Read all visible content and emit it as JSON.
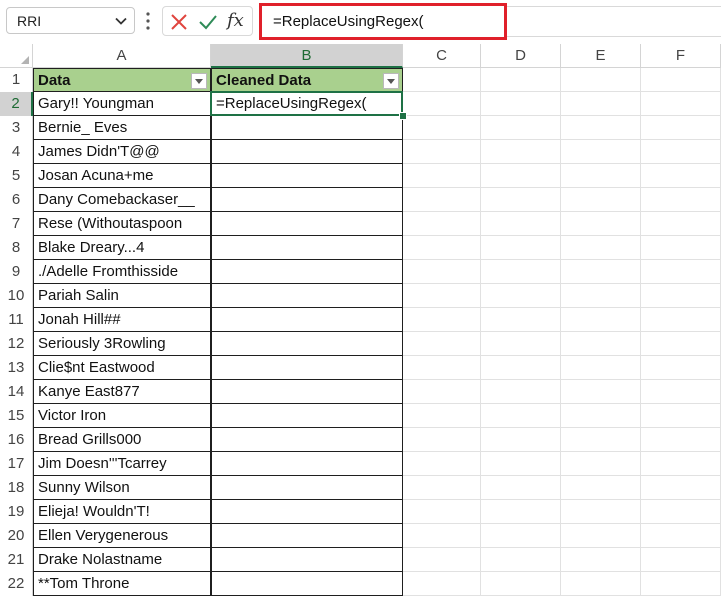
{
  "formula_bar": {
    "name_box": "RRI",
    "formula": "=ReplaceUsingRegex("
  },
  "columns": [
    "A",
    "B",
    "C",
    "D",
    "E",
    "F"
  ],
  "table": {
    "headers": [
      "Data",
      "Cleaned Data"
    ],
    "header_color": "#a9d08e",
    "rows": [
      {
        "n": "2",
        "a": "Gary!! Youngman",
        "b": "=ReplaceUsingRegex("
      },
      {
        "n": "3",
        "a": "Bernie_ Eves",
        "b": ""
      },
      {
        "n": "4",
        "a": "James Didn'T@@",
        "b": ""
      },
      {
        "n": "5",
        "a": "Josan Acuna+me",
        "b": ""
      },
      {
        "n": "6",
        "a": "Dany Comebackaser__",
        "b": ""
      },
      {
        "n": "7",
        "a": "Rese (Withoutaspoon",
        "b": ""
      },
      {
        "n": "8",
        "a": "Blake Dreary...4",
        "b": ""
      },
      {
        "n": "9",
        "a": "./Adelle Fromthisside",
        "b": ""
      },
      {
        "n": "10",
        "a": "Pariah Salin",
        "b": ""
      },
      {
        "n": "11",
        "a": "Jonah Hill##",
        "b": ""
      },
      {
        "n": "12",
        "a": "Seriously 3Rowling",
        "b": ""
      },
      {
        "n": "13",
        "a": "Clie$nt Eastwood",
        "b": ""
      },
      {
        "n": "14",
        "a": "Kanye East877",
        "b": ""
      },
      {
        "n": "15",
        "a": "Victor Iron",
        "b": ""
      },
      {
        "n": "16",
        "a": "Bread Grills000",
        "b": ""
      },
      {
        "n": "17",
        "a": "Jim Doesn'''Tcarrey",
        "b": ""
      },
      {
        "n": "18",
        "a": "Sunny Wilson",
        "b": ""
      },
      {
        "n": "19",
        "a": "Elieja! Wouldn'T!",
        "b": ""
      },
      {
        "n": "20",
        "a": "Ellen Verygenerous",
        "b": ""
      },
      {
        "n": "21",
        "a": "Drake Nolastname",
        "b": ""
      },
      {
        "n": "22",
        "a": "**Tom Throne",
        "b": ""
      }
    ]
  },
  "header_row_number": "1",
  "active_cell": "B2",
  "accent_color": "#1e7145",
  "highlight_color": "#e0202a"
}
